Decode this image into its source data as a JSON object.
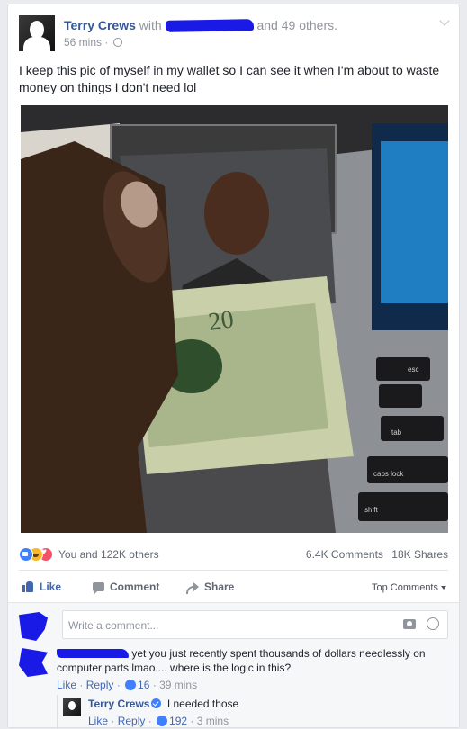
{
  "post": {
    "author": "Terry Crews",
    "with_label": "with",
    "others": "and 49 others.",
    "time": "56 mins",
    "privacy_icon": "globe-icon",
    "text": "I keep this pic of myself in my wallet so I can see it when I'm about to waste money on things I don't need lol"
  },
  "reactions": {
    "summary": "You and 122K others",
    "comments": "6.4K Comments",
    "shares": "18K Shares"
  },
  "actions": {
    "like": "Like",
    "comment": "Comment",
    "share": "Share",
    "top_comments": "Top Comments"
  },
  "composer": {
    "placeholder": "Write a comment..."
  },
  "comments": [
    {
      "text": "yet you just recently spent thousands of dollars needlessly on computer parts lmao.... where is the logic in this?",
      "like": "Like",
      "reply": "Reply",
      "likes": "16",
      "time": "39 mins"
    }
  ],
  "replies": [
    {
      "author": "Terry Crews",
      "text": "I needed those",
      "like": "Like",
      "reply": "Reply",
      "likes": "192",
      "time": "3 mins"
    }
  ],
  "colors": {
    "link": "#365899",
    "action_blue": "#4267b2",
    "redaction": "#1a1ae6"
  }
}
